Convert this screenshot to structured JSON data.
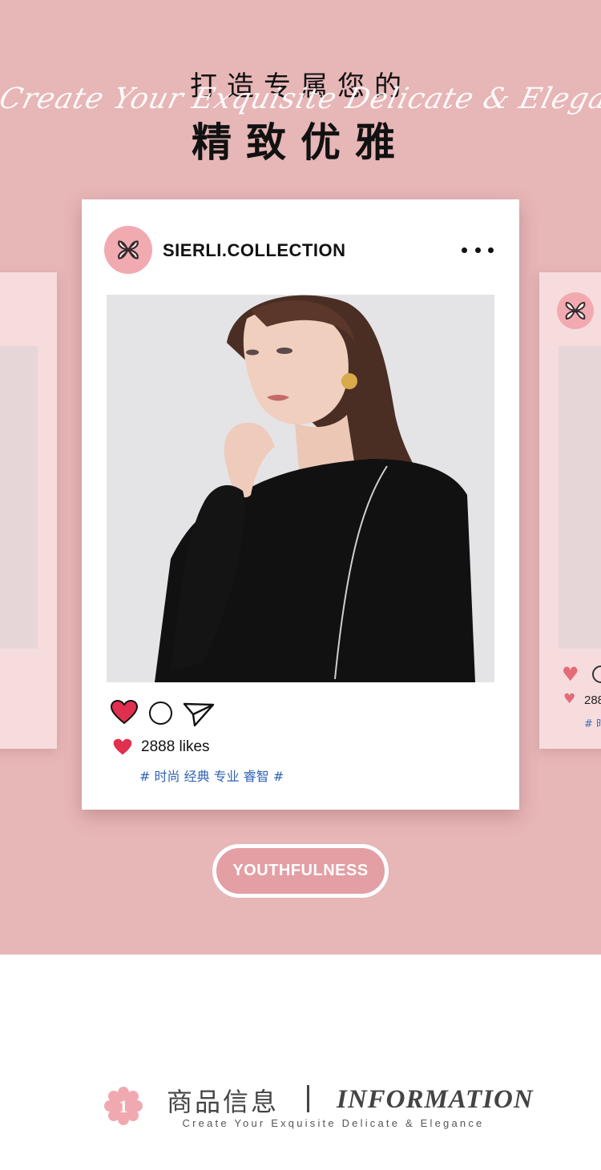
{
  "header": {
    "title_top": "打造专属您的",
    "script_line": "Create Your Exquisite Delicate & Elegance",
    "title_main": "精致优雅"
  },
  "post": {
    "username": "SIERLI.COLLECTION",
    "more_icon": "more-horizontal-icon",
    "likes_text": "2888 likes",
    "hashtags": "# 时尚 经典 专业 睿智 #",
    "like_color": "#e02f4f",
    "hashtag_color": "#2f63b4"
  },
  "side_card_right": {
    "likes_text": "288",
    "hashtags": "# 时"
  },
  "tag_button": {
    "label": "YOUTHFULNESS"
  },
  "section": {
    "number": "1",
    "title_cn": "商品信息",
    "title_en": "INFORMATION",
    "subtitle": "Create Your Exquisite Delicate & Elegance"
  },
  "colors": {
    "hero_bg": "#e7b6b7",
    "accent_pink": "#e39fa4",
    "logo_pink": "#f2aab1"
  }
}
